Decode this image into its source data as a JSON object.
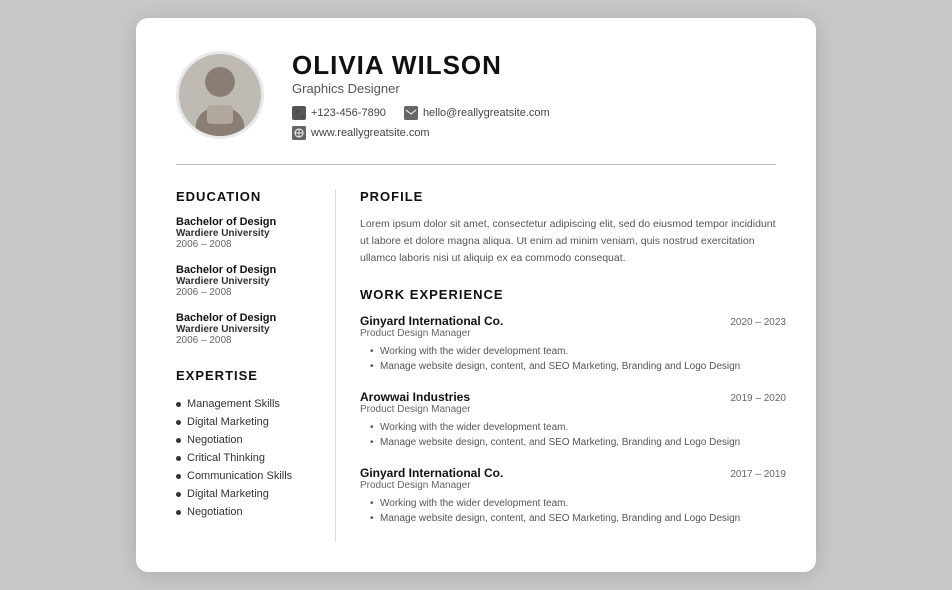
{
  "header": {
    "name": "OLIVIA WILSON",
    "title": "Graphics Designer",
    "phone": "+123-456-7890",
    "email": "hello@reallygreatsite.com",
    "website": "www.reallygreatsite.com"
  },
  "education": {
    "section_title": "EDUCATION",
    "entries": [
      {
        "degree": "Bachelor of Design",
        "school": "Wardiere University",
        "years": "2006 – 2008"
      },
      {
        "degree": "Bachelor of Design",
        "school": "Wardiere University",
        "years": "2006 – 2008"
      },
      {
        "degree": "Bachelor of Design",
        "school": "Wardiere University",
        "years": "2006 – 2008"
      }
    ]
  },
  "expertise": {
    "section_title": "EXPERTISE",
    "items": [
      "Management Skills",
      "Digital Marketing",
      "Negotiation",
      "Critical Thinking",
      "Communication Skills",
      "Digital Marketing",
      "Negotiation"
    ]
  },
  "profile": {
    "section_title": "PROFILE",
    "text": "Lorem ipsum dolor sit amet, consectetur adipiscing elit, sed do eiusmod tempor incididunt ut labore et dolore magna aliqua. Ut enim ad minim veniam, quis nostrud exercitation ullamco laboris nisi ut aliquip ex ea commodo consequat."
  },
  "work_experience": {
    "section_title": "WORK EXPERIENCE",
    "entries": [
      {
        "company": "Ginyard International Co.",
        "years": "2020 – 2023",
        "role": "Product Design Manager",
        "bullets": [
          "Working with the wider development team.",
          "Manage website design, content, and SEO Marketing, Branding and Logo Design"
        ]
      },
      {
        "company": "Arowwai Industries",
        "years": "2019 – 2020",
        "role": "Product Design Manager",
        "bullets": [
          "Working with the wider development team.",
          "Manage website design, content, and SEO Marketing, Branding and Logo Design"
        ]
      },
      {
        "company": "Ginyard International Co.",
        "years": "2017 – 2019",
        "role": "Product Design Manager",
        "bullets": [
          "Working with the wider development team.",
          "Manage website design, content, and SEO Marketing, Branding and Logo Design"
        ]
      }
    ]
  }
}
